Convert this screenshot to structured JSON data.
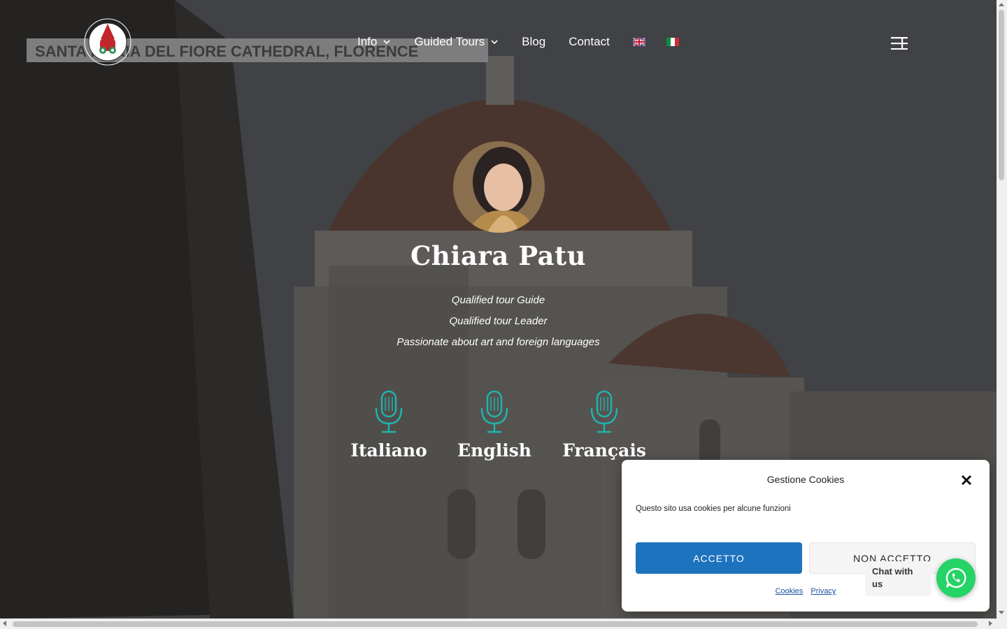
{
  "header": {
    "logo_text_top": "Chiara Patu",
    "logo_text_ring": "FLORENCE TOUR GUIDE",
    "nav": [
      {
        "label": "Info",
        "has_dropdown": true
      },
      {
        "label": "Guided Tours",
        "has_dropdown": true
      },
      {
        "label": "Blog",
        "has_dropdown": false
      },
      {
        "label": "Contact",
        "has_dropdown": false
      }
    ],
    "flags": [
      "uk-flag-icon",
      "italy-flag-icon"
    ]
  },
  "background": {
    "sign_text": "SANTA MARIA DEL FIORE CATHEDRAL, FLORENCE"
  },
  "hero": {
    "name": "Chiara Patu",
    "lines": [
      "Qualified tour Guide",
      "Qualified tour Leader",
      "Passionate about art and foreign languages"
    ],
    "languages": [
      "Italiano",
      "English",
      "Français"
    ],
    "icon_color": "#1fb5ad"
  },
  "cookie": {
    "title": "Gestione Cookies",
    "text": "Questo sito usa cookies per alcune funzioni",
    "accept_label": "ACCETTO",
    "deny_label": "NON ACCETTO",
    "links": [
      "Cookies",
      "Privacy"
    ]
  },
  "whatsapp": {
    "label": "Chat with us",
    "color": "#25d366"
  }
}
